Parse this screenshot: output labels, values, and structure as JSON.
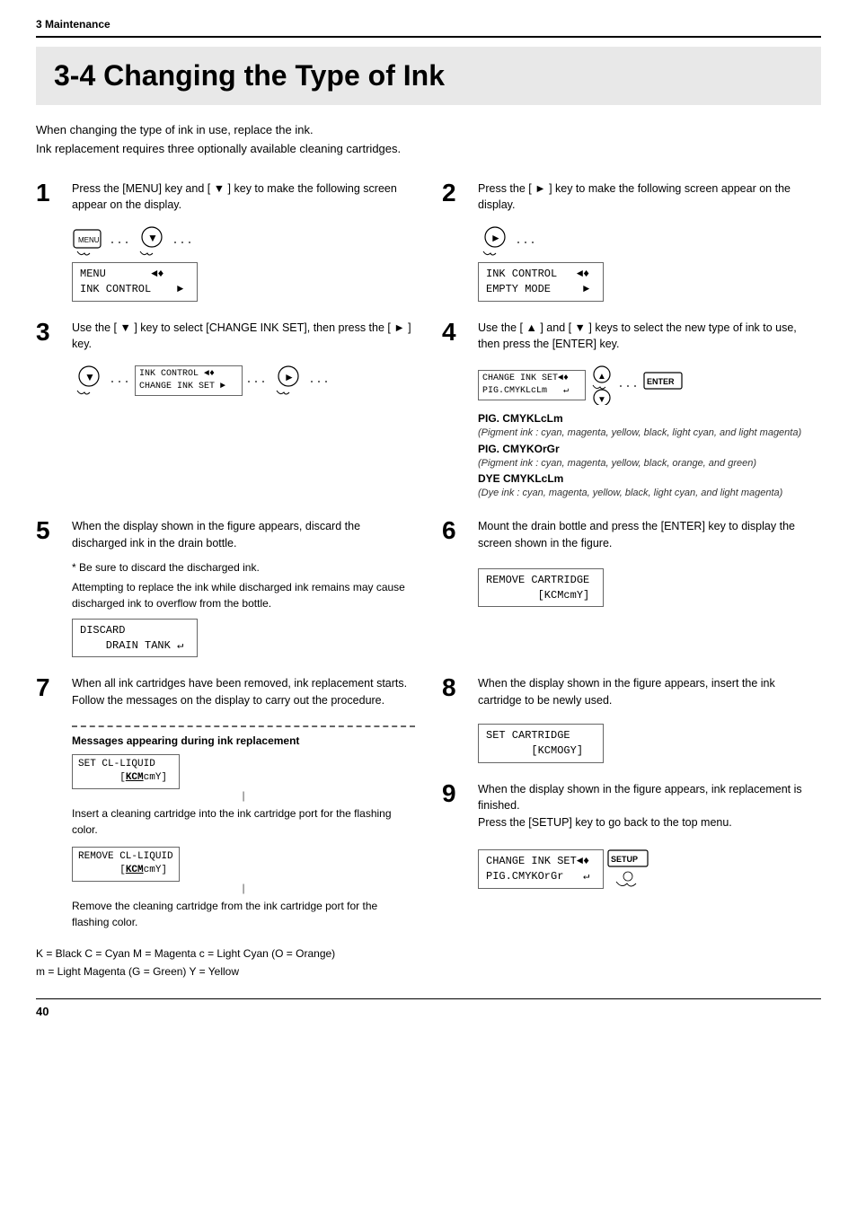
{
  "breadcrumb": "3  Maintenance",
  "chapter": {
    "title": "3-4  Changing the Type of Ink"
  },
  "intro": {
    "line1": "When changing the type of ink in use, replace the ink.",
    "line2": "Ink replacement requires three optionally available cleaning cartridges."
  },
  "steps": [
    {
      "number": "1",
      "text": "Press the [MENU] key and [ ▼ ] key to make the following screen appear on the display.",
      "lcd": [
        "MENU          ◄♦",
        "INK CONTROL       ►"
      ]
    },
    {
      "number": "2",
      "text": "Press the [ ► ] key to make the following screen appear on the display.",
      "lcd": [
        "INK CONTROL    ◄♦",
        "EMPTY MODE        ►"
      ]
    },
    {
      "number": "3",
      "text": "Use the [ ▼ ] key to select [CHANGE INK SET], then press the [ ► ] key.",
      "lcd_left": [
        "INK CONTROL  ◄♦",
        "CHANGE INK SET ►"
      ],
      "has_arrow": true
    },
    {
      "number": "4",
      "text": "Use the [ ▲ ] and [ ▼ ] keys to select the new type of ink to use, then press the [ENTER] key.",
      "lcd": [
        "CHANGE INK SET◄♦",
        "PIG.CMYKLcLm      ↵"
      ],
      "options": [
        {
          "label": "PIG. CMYKLcLm",
          "bold": true,
          "note": "(Pigment ink : cyan, magenta, yellow, black, light cyan, and light magenta)"
        },
        {
          "label": "PIG. CMYKOrGr",
          "bold": true,
          "note": "(Pigment ink : cyan, magenta, yellow, black, orange, and green)"
        },
        {
          "label": "DYE CMYKLcLm",
          "bold": true,
          "note": "(Dye ink : cyan, magenta, yellow, black, light cyan, and light magenta)"
        }
      ]
    },
    {
      "number": "5",
      "text": "When the display shown in the figure appears, discard the discharged ink in the drain bottle.",
      "asterisk": "* Be sure to discard the discharged ink.",
      "extra_note": "Attempting to replace the ink while discharged ink remains may cause discharged ink to overflow from the bottle.",
      "lcd": [
        "DISCARD",
        "    DRAIN TANK ↵"
      ]
    },
    {
      "number": "6",
      "text": "Mount the drain bottle and press the [ENTER] key to display the screen shown in the figure.",
      "lcd": [
        "REMOVE CARTRIDGE",
        "        [KCMcmY]"
      ]
    },
    {
      "number": "7",
      "text": "When all ink cartridges have been removed, ink replacement starts.  Follow the messages on the display to carry out the procedure.",
      "dashed": true,
      "messages_label": "Messages appearing during ink replacement",
      "message_blocks": [
        {
          "lcd": [
            "SET CL-LIQUID",
            "       [KCMcmY]"
          ],
          "note": "Insert a cleaning cartridge into the ink cartridge port for the flashing color."
        },
        {
          "lcd": [
            "REMOVE CL-LIQUID",
            "       [KCMcmY]"
          ],
          "note": "Remove the cleaning cartridge from the ink cartridge port for the flashing color."
        }
      ]
    },
    {
      "number": "8",
      "text": "When the display shown in the figure appears, insert the ink cartridge to be newly used.",
      "lcd": [
        "SET CARTRIDGE",
        "       [KCMOGY]"
      ]
    },
    {
      "number": "9",
      "text_lines": [
        "When the display shown in the figure appears, ink replacement is finished.",
        "Press the [SETUP] key to go back to the top menu."
      ],
      "lcd": [
        "CHANGE INK SET◄♦",
        "PIG.CMYKOrGr      ↵"
      ]
    }
  ],
  "color_codes": {
    "line1": "K = Black    C = Cyan    M = Magenta    c = Light Cyan (O = Orange)",
    "line2": "m = Light Magenta (G = Green)     Y = Yellow"
  },
  "page_number": "40",
  "labels": {
    "kcm_bold": "KCM",
    "messages_label": "Messages appearing during ink replacement"
  }
}
